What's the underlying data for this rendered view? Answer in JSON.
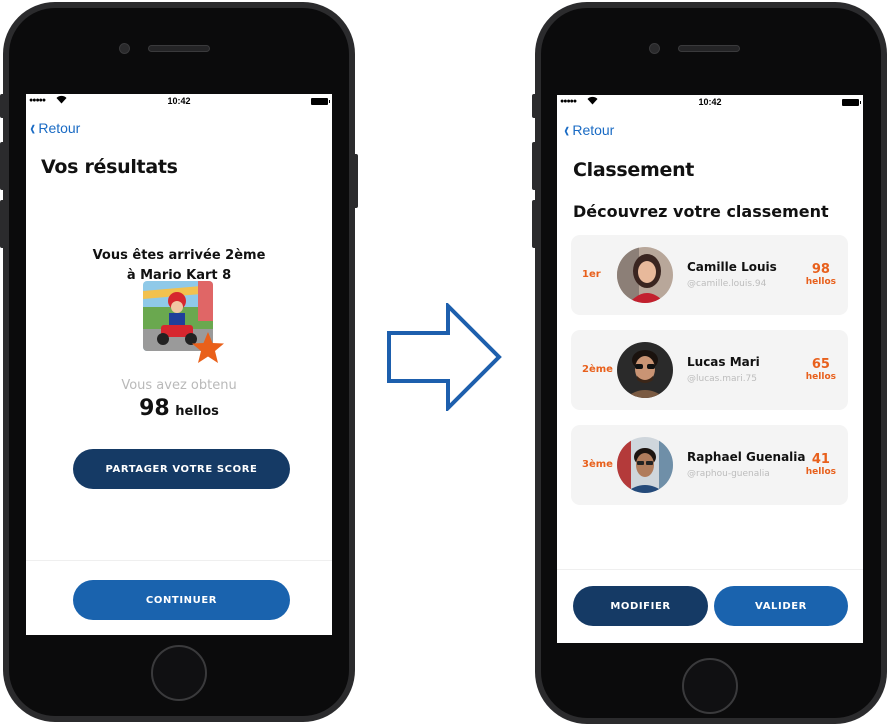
{
  "status_bar": {
    "signal": "●●●●●",
    "time": "10:42"
  },
  "left_screen": {
    "back_label": "Retour",
    "title": "Vos résultats",
    "result_line_1": "Vous êtes arrivée 2ème",
    "result_line_2": "à Mario Kart 8",
    "game_image_icon": "mario-kart-image",
    "badge_icon": "star-icon",
    "obtained_label": "Vous avez obtenu",
    "score_value": "98",
    "score_unit": "hellos",
    "share_button": "PARTAGER VOTRE SCORE",
    "continue_button": "CONTINUER"
  },
  "arrow_icon": "right-arrow-icon",
  "right_screen": {
    "back_label": "Retour",
    "title": "Classement",
    "subtitle": "Découvrez votre classement",
    "ranking": [
      {
        "position": "1er",
        "name": "Camille Louis",
        "handle": "@camille.louis.94",
        "score": "98",
        "unit": "hellos"
      },
      {
        "position": "2ème",
        "name": "Lucas Mari",
        "handle": "@lucas.mari.75",
        "score": "65",
        "unit": "hellos"
      },
      {
        "position": "3ème",
        "name": "Raphael Guenalia",
        "handle": "@raphou-guenalia",
        "score": "41",
        "unit": "hellos"
      }
    ],
    "modify_button": "MODIFIER",
    "validate_button": "VALIDER"
  },
  "colors": {
    "accent_blue": "#1a63ae",
    "dark_blue": "#153a65",
    "link_blue": "#1a6bc4",
    "orange": "#e8601c",
    "arrow_blue": "#1d5fad"
  }
}
